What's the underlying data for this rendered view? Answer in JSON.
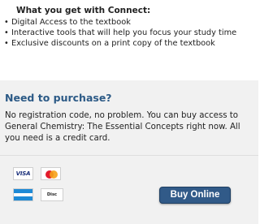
{
  "connect": {
    "title": "What you get with Connect:",
    "bullet": "•",
    "items": [
      "Digital Access to the textbook",
      "Interactive tools that will help you focus your study time",
      "Exclusive discounts on a print copy of the textbook"
    ]
  },
  "purchase": {
    "title": "Need to purchase?",
    "text": "No registration code, no problem. You can buy access to General Chemistry: The Essential Concepts right now. All you need is a credit card.",
    "cards": {
      "visa": "VISA",
      "discover_prefix": "Disc",
      "discover_o": "o",
      "discover_suffix": "ver"
    },
    "buy_label": "Buy Online"
  },
  "colors": {
    "heading_blue": "#2c5a86",
    "button_blue": "#315a88",
    "panel_gray": "#f1f1f1"
  }
}
